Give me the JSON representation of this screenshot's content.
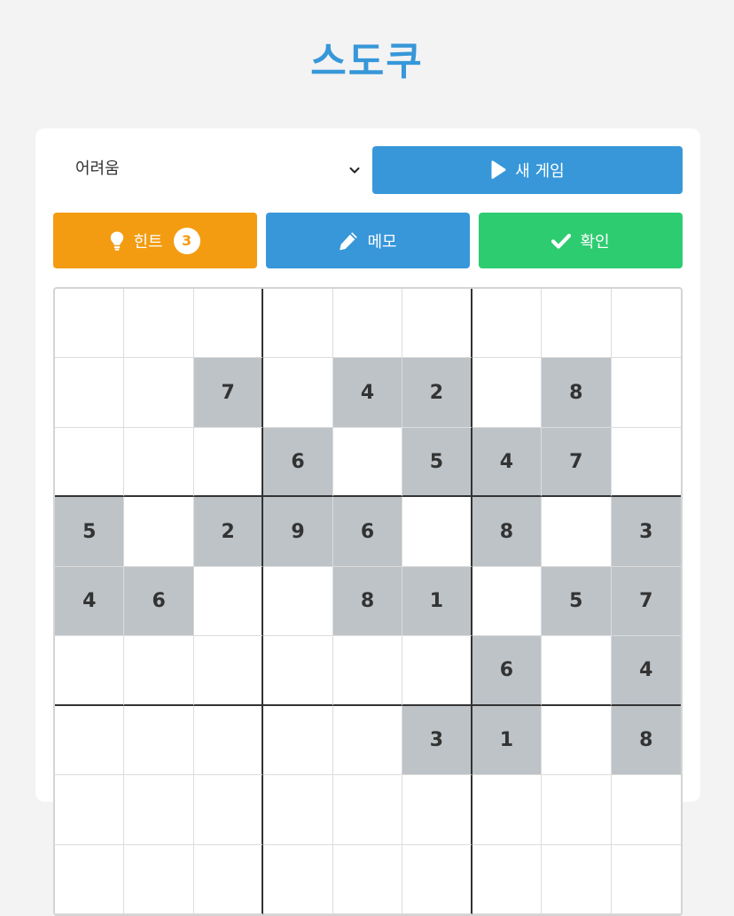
{
  "title": "스도쿠",
  "controls": {
    "difficulty": {
      "selected": "어려움"
    },
    "new_game_label": "새 게임",
    "hint_label": "힌트",
    "hint_count": "3",
    "memo_label": "메모",
    "check_label": "확인"
  },
  "icons": {
    "play": "play-icon",
    "hint": "lightbulb-icon",
    "memo": "pencil-icon",
    "check": "checkmark-icon",
    "dropdown": "chevron-down-icon"
  },
  "colors": {
    "title": "#3797d9",
    "primary": "#3797d9",
    "hint": "#f39c12",
    "check": "#2ecc71",
    "given_cell": "#bdc3c7"
  },
  "board": [
    [
      "",
      "",
      "",
      "",
      "",
      "",
      "",
      "",
      ""
    ],
    [
      "",
      "",
      "7",
      "",
      "4",
      "2",
      "",
      "8",
      ""
    ],
    [
      "",
      "",
      "",
      "6",
      "",
      "5",
      "4",
      "7",
      ""
    ],
    [
      "5",
      "",
      "2",
      "9",
      "6",
      "",
      "8",
      "",
      "3"
    ],
    [
      "4",
      "6",
      "",
      "",
      "8",
      "1",
      "",
      "5",
      "7"
    ],
    [
      "",
      "",
      "",
      "",
      "",
      "",
      "6",
      "",
      "4"
    ],
    [
      "",
      "",
      "",
      "",
      "",
      "3",
      "1",
      "",
      "8"
    ],
    [
      "",
      "",
      "",
      "",
      "",
      "",
      "",
      "",
      ""
    ],
    [
      "",
      "",
      "",
      "",
      "",
      "",
      "",
      "",
      ""
    ]
  ]
}
